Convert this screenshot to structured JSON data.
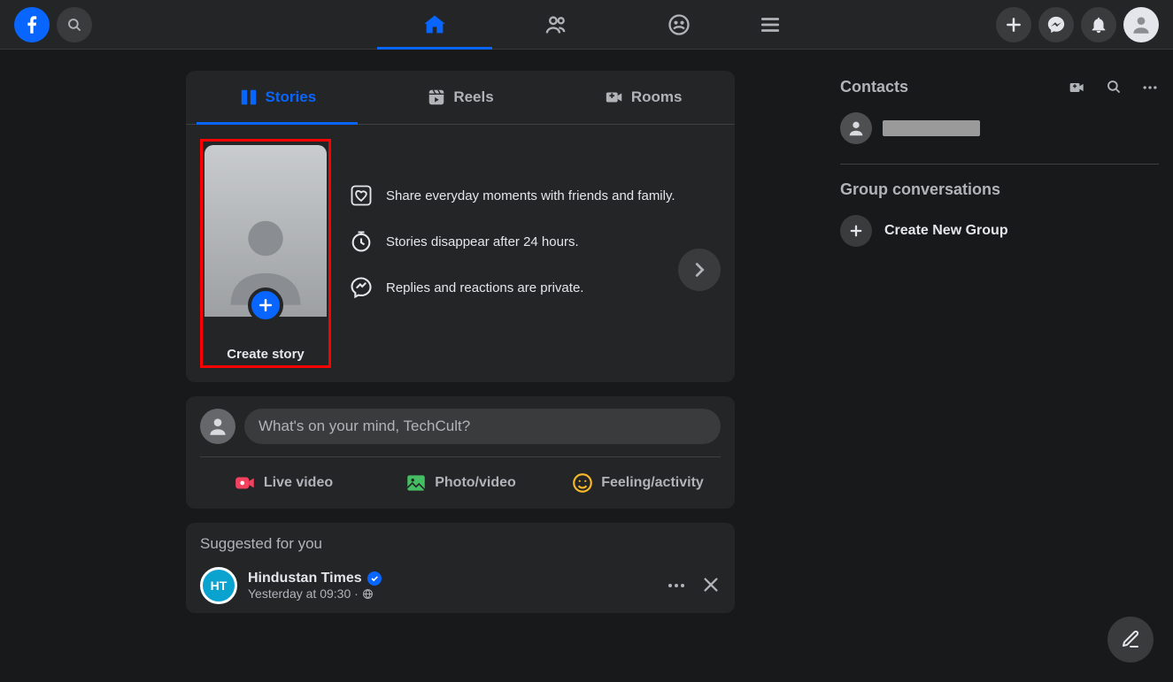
{
  "header": {
    "nav": {
      "home": "Home",
      "friends": "Friends",
      "groups": "Groups",
      "menu": "Menu"
    }
  },
  "stories_section": {
    "tabs": {
      "stories": "Stories",
      "reels": "Reels",
      "rooms": "Rooms"
    },
    "create_label": "Create story",
    "info": {
      "line1": "Share everyday moments with friends and family.",
      "line2": "Stories disappear after 24 hours.",
      "line3": "Replies and reactions are private."
    }
  },
  "composer": {
    "placeholder": "What's on your mind, TechCult?",
    "actions": {
      "live": "Live video",
      "photo": "Photo/video",
      "feeling": "Feeling/activity"
    }
  },
  "suggested": {
    "title": "Suggested for you",
    "page": {
      "avatar_text": "HT",
      "name": "Hindustan Times",
      "subtitle": "Yesterday at 09:30 ·"
    }
  },
  "contacts": {
    "title": "Contacts",
    "group_title": "Group conversations",
    "create_group": "Create New Group"
  }
}
